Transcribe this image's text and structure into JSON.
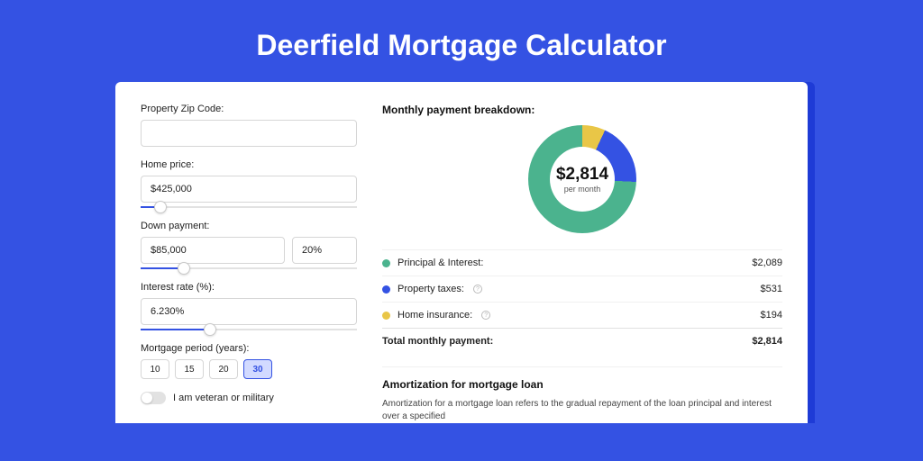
{
  "title": "Deerfield Mortgage Calculator",
  "fields": {
    "zip_label": "Property Zip Code:",
    "zip_value": "",
    "home_price_label": "Home price:",
    "home_price_value": "$425,000",
    "down_payment_label": "Down payment:",
    "down_payment_value": "$85,000",
    "down_payment_pct": "20%",
    "interest_label": "Interest rate (%):",
    "interest_value": "6.230%",
    "period_label": "Mortgage period (years):",
    "period_options": [
      "10",
      "15",
      "20",
      "30"
    ],
    "period_active": "30",
    "veteran_label": "I am veteran or military"
  },
  "breakdown": {
    "title": "Monthly payment breakdown:",
    "center_value": "$2,814",
    "center_sub": "per month",
    "items": [
      {
        "label": "Principal & Interest:",
        "value": "$2,089",
        "color": "green",
        "help": false
      },
      {
        "label": "Property taxes:",
        "value": "$531",
        "color": "blue",
        "help": true
      },
      {
        "label": "Home insurance:",
        "value": "$194",
        "color": "yellow",
        "help": true
      }
    ],
    "total_label": "Total monthly payment:",
    "total_value": "$2,814"
  },
  "amort": {
    "title": "Amortization for mortgage loan",
    "text": "Amortization for a mortgage loan refers to the gradual repayment of the loan principal and interest over a specified"
  },
  "chart_data": {
    "type": "pie",
    "title": "Monthly payment breakdown",
    "series": [
      {
        "name": "Principal & Interest",
        "value": 2089,
        "color": "#4bb38e"
      },
      {
        "name": "Property taxes",
        "value": 531,
        "color": "#3452e3"
      },
      {
        "name": "Home insurance",
        "value": 194,
        "color": "#e9c647"
      }
    ],
    "total": 2814,
    "center_label": "$2,814 per month"
  }
}
